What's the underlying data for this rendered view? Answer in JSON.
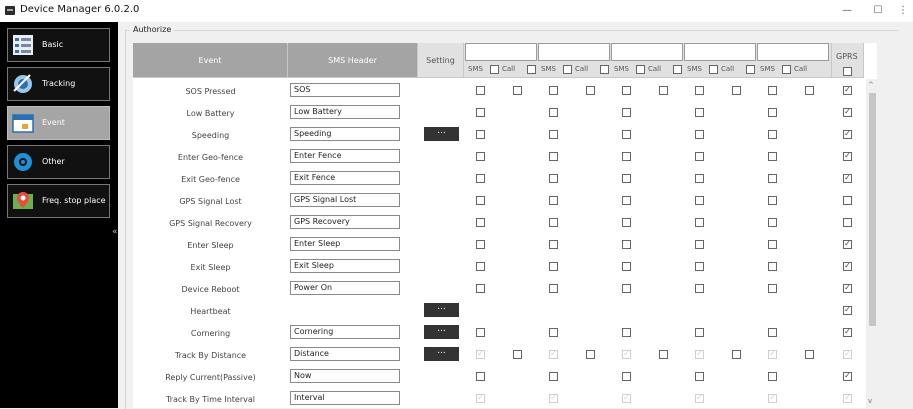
{
  "window": {
    "title": "Device Manager 6.0.2.0",
    "minimize": "—",
    "maximize": "☐",
    "more": "⋮"
  },
  "sidebar": {
    "items": [
      {
        "label": "Basic",
        "icon": "list-icon",
        "active": false
      },
      {
        "label": "Tracking",
        "icon": "satellite-icon",
        "active": false
      },
      {
        "label": "Event",
        "icon": "calendar-icon",
        "active": true
      },
      {
        "label": "Other",
        "icon": "gear-icon",
        "active": false
      },
      {
        "label": "Freq. stop place",
        "icon": "map-pin-icon",
        "active": false
      }
    ],
    "collapse": "«"
  },
  "authorize": {
    "group_label": "Authorize",
    "headers": {
      "event": "Event",
      "sms_header": "SMS Header",
      "setting": "Setting",
      "gprs": "GPRS",
      "sms": "SMS",
      "call": "Call"
    },
    "channels": [
      "",
      "",
      "",
      "",
      ""
    ],
    "channel_checked": [
      false,
      false,
      false,
      false,
      false
    ],
    "gprs_all_checked": false,
    "rows": [
      {
        "event": "SOS Pressed",
        "header": "SOS",
        "setting": false,
        "pairs": [
          [
            0,
            0
          ],
          [
            0,
            0
          ],
          [
            0,
            0
          ],
          [
            0,
            0
          ],
          [
            0,
            0
          ]
        ],
        "gprs": 1
      },
      {
        "event": "Low Battery",
        "header": "Low Battery",
        "setting": false,
        "pairs": [
          [
            0,
            null
          ],
          [
            0,
            null
          ],
          [
            0,
            null
          ],
          [
            0,
            null
          ],
          [
            0,
            null
          ]
        ],
        "gprs": 1
      },
      {
        "event": "Speeding",
        "header": "Speeding",
        "setting": true,
        "pairs": [
          [
            0,
            null
          ],
          [
            0,
            null
          ],
          [
            0,
            null
          ],
          [
            0,
            null
          ],
          [
            0,
            null
          ]
        ],
        "gprs": 1
      },
      {
        "event": "Enter Geo-fence",
        "header": "Enter Fence",
        "setting": false,
        "pairs": [
          [
            0,
            null
          ],
          [
            0,
            null
          ],
          [
            0,
            null
          ],
          [
            0,
            null
          ],
          [
            0,
            null
          ]
        ],
        "gprs": 1
      },
      {
        "event": "Exit Geo-fence",
        "header": "Exit Fence",
        "setting": false,
        "pairs": [
          [
            0,
            null
          ],
          [
            0,
            null
          ],
          [
            0,
            null
          ],
          [
            0,
            null
          ],
          [
            0,
            null
          ]
        ],
        "gprs": 1
      },
      {
        "event": "GPS Signal Lost",
        "header": "GPS Signal Lost",
        "setting": false,
        "pairs": [
          [
            0,
            null
          ],
          [
            0,
            null
          ],
          [
            0,
            null
          ],
          [
            0,
            null
          ],
          [
            0,
            null
          ]
        ],
        "gprs": 0
      },
      {
        "event": "GPS Signal Recovery",
        "header": "GPS Recovery",
        "setting": false,
        "pairs": [
          [
            0,
            null
          ],
          [
            0,
            null
          ],
          [
            0,
            null
          ],
          [
            0,
            null
          ],
          [
            0,
            null
          ]
        ],
        "gprs": 0
      },
      {
        "event": "Enter Sleep",
        "header": "Enter Sleep",
        "setting": false,
        "pairs": [
          [
            0,
            null
          ],
          [
            0,
            null
          ],
          [
            0,
            null
          ],
          [
            0,
            null
          ],
          [
            0,
            null
          ]
        ],
        "gprs": 1
      },
      {
        "event": "Exit Sleep",
        "header": "Exit Sleep",
        "setting": false,
        "pairs": [
          [
            0,
            null
          ],
          [
            0,
            null
          ],
          [
            0,
            null
          ],
          [
            0,
            null
          ],
          [
            0,
            null
          ]
        ],
        "gprs": 1
      },
      {
        "event": "Device Reboot",
        "header": "Power On",
        "setting": false,
        "pairs": [
          [
            0,
            null
          ],
          [
            0,
            null
          ],
          [
            0,
            null
          ],
          [
            0,
            null
          ],
          [
            0,
            null
          ]
        ],
        "gprs": 1
      },
      {
        "event": "Heartbeat",
        "header": null,
        "setting": true,
        "pairs": [
          [
            null,
            null
          ],
          [
            null,
            null
          ],
          [
            null,
            null
          ],
          [
            null,
            null
          ],
          [
            null,
            null
          ]
        ],
        "gprs": 1
      },
      {
        "event": "Cornering",
        "header": "Cornering",
        "setting": true,
        "pairs": [
          [
            0,
            null
          ],
          [
            0,
            null
          ],
          [
            0,
            null
          ],
          [
            0,
            null
          ],
          [
            0,
            null
          ]
        ],
        "gprs": 1
      },
      {
        "event": "Track By Distance",
        "header": "Distance",
        "setting": true,
        "pairs": [
          [
            2,
            0
          ],
          [
            2,
            0
          ],
          [
            2,
            0
          ],
          [
            2,
            0
          ],
          [
            2,
            0
          ]
        ],
        "gprs": 2
      },
      {
        "event": "Reply Current(Passive)",
        "header": "Now",
        "setting": false,
        "pairs": [
          [
            0,
            null
          ],
          [
            0,
            null
          ],
          [
            0,
            null
          ],
          [
            0,
            null
          ],
          [
            0,
            null
          ]
        ],
        "gprs": 1
      },
      {
        "event": "Track By Time Interval",
        "header": "Interval",
        "setting": false,
        "pairs": [
          [
            2,
            null
          ],
          [
            2,
            null
          ],
          [
            2,
            null
          ],
          [
            2,
            null
          ],
          [
            2,
            null
          ]
        ],
        "gprs": 2
      }
    ],
    "setting_button": "...",
    "scroll_up": "^",
    "scroll_down": "v"
  }
}
